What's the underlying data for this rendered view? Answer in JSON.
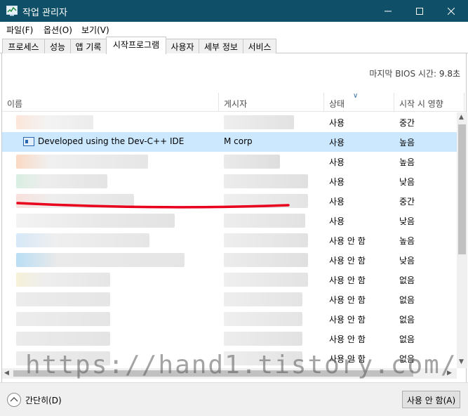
{
  "window": {
    "title": "작업 관리자"
  },
  "menu": [
    "파일(F)",
    "옵션(O)",
    "보기(V)"
  ],
  "tabs": [
    "프로세스",
    "성능",
    "앱 기록",
    "시작프로그램",
    "사용자",
    "세부 정보",
    "서비스"
  ],
  "active_tab": "시작프로그램",
  "bios": {
    "label": "마지막 BIOS 시간:",
    "value": "9.8초"
  },
  "columns": {
    "name": "이름",
    "publisher": "게시자",
    "status": "상태",
    "impact": "시작 시 영향"
  },
  "rows": [
    {
      "name": "",
      "publisher": "",
      "status": "사용",
      "impact": "중간"
    },
    {
      "name": "Developed using the Dev-C++ IDE",
      "publisher": "M corp",
      "status": "사용",
      "impact": "높음",
      "selected": true
    },
    {
      "name": "",
      "publisher": "",
      "status": "사용",
      "impact": "높음"
    },
    {
      "name": "",
      "publisher": "",
      "status": "사용",
      "impact": "낮음"
    },
    {
      "name": "",
      "publisher": "",
      "status": "사용",
      "impact": "중간"
    },
    {
      "name": "",
      "publisher": "",
      "status": "사용",
      "impact": "낮음"
    },
    {
      "name": "",
      "publisher": "",
      "status": "사용 안 함",
      "impact": "높음"
    },
    {
      "name": "",
      "publisher": "",
      "status": "사용 안 함",
      "impact": "낮음"
    },
    {
      "name": "",
      "publisher": "",
      "status": "사용 안 함",
      "impact": "없음"
    },
    {
      "name": "",
      "publisher": "",
      "status": "사용 안 함",
      "impact": "없음"
    },
    {
      "name": "",
      "publisher": "",
      "status": "사용 안 함",
      "impact": "없음"
    },
    {
      "name": "",
      "publisher": "",
      "status": "사용 안 함",
      "impact": "없음"
    },
    {
      "name": "",
      "publisher": "",
      "status": "사용 안 함",
      "impact": "없음"
    }
  ],
  "footer": {
    "collapse_label": "간단히(D)",
    "disable_button": "사용 안 함(A)"
  },
  "watermark": "https://hand1.tistory.com/",
  "colors": {
    "titlebar": "#0f5068",
    "selected_row": "#cce8ff",
    "annotation": "#e8001c"
  }
}
